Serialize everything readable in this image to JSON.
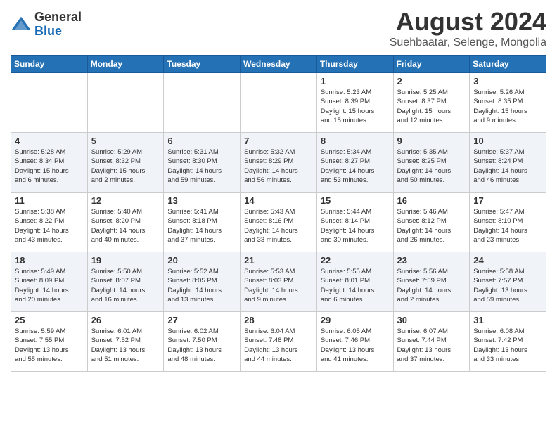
{
  "logo": {
    "general": "General",
    "blue": "Blue"
  },
  "title": "August 2024",
  "subtitle": "Suehbaatar, Selenge, Mongolia",
  "days_of_week": [
    "Sunday",
    "Monday",
    "Tuesday",
    "Wednesday",
    "Thursday",
    "Friday",
    "Saturday"
  ],
  "weeks": [
    [
      {
        "day": "",
        "info": ""
      },
      {
        "day": "",
        "info": ""
      },
      {
        "day": "",
        "info": ""
      },
      {
        "day": "",
        "info": ""
      },
      {
        "day": "1",
        "info": "Sunrise: 5:23 AM\nSunset: 8:39 PM\nDaylight: 15 hours\nand 15 minutes."
      },
      {
        "day": "2",
        "info": "Sunrise: 5:25 AM\nSunset: 8:37 PM\nDaylight: 15 hours\nand 12 minutes."
      },
      {
        "day": "3",
        "info": "Sunrise: 5:26 AM\nSunset: 8:35 PM\nDaylight: 15 hours\nand 9 minutes."
      }
    ],
    [
      {
        "day": "4",
        "info": "Sunrise: 5:28 AM\nSunset: 8:34 PM\nDaylight: 15 hours\nand 6 minutes."
      },
      {
        "day": "5",
        "info": "Sunrise: 5:29 AM\nSunset: 8:32 PM\nDaylight: 15 hours\nand 2 minutes."
      },
      {
        "day": "6",
        "info": "Sunrise: 5:31 AM\nSunset: 8:30 PM\nDaylight: 14 hours\nand 59 minutes."
      },
      {
        "day": "7",
        "info": "Sunrise: 5:32 AM\nSunset: 8:29 PM\nDaylight: 14 hours\nand 56 minutes."
      },
      {
        "day": "8",
        "info": "Sunrise: 5:34 AM\nSunset: 8:27 PM\nDaylight: 14 hours\nand 53 minutes."
      },
      {
        "day": "9",
        "info": "Sunrise: 5:35 AM\nSunset: 8:25 PM\nDaylight: 14 hours\nand 50 minutes."
      },
      {
        "day": "10",
        "info": "Sunrise: 5:37 AM\nSunset: 8:24 PM\nDaylight: 14 hours\nand 46 minutes."
      }
    ],
    [
      {
        "day": "11",
        "info": "Sunrise: 5:38 AM\nSunset: 8:22 PM\nDaylight: 14 hours\nand 43 minutes."
      },
      {
        "day": "12",
        "info": "Sunrise: 5:40 AM\nSunset: 8:20 PM\nDaylight: 14 hours\nand 40 minutes."
      },
      {
        "day": "13",
        "info": "Sunrise: 5:41 AM\nSunset: 8:18 PM\nDaylight: 14 hours\nand 37 minutes."
      },
      {
        "day": "14",
        "info": "Sunrise: 5:43 AM\nSunset: 8:16 PM\nDaylight: 14 hours\nand 33 minutes."
      },
      {
        "day": "15",
        "info": "Sunrise: 5:44 AM\nSunset: 8:14 PM\nDaylight: 14 hours\nand 30 minutes."
      },
      {
        "day": "16",
        "info": "Sunrise: 5:46 AM\nSunset: 8:12 PM\nDaylight: 14 hours\nand 26 minutes."
      },
      {
        "day": "17",
        "info": "Sunrise: 5:47 AM\nSunset: 8:10 PM\nDaylight: 14 hours\nand 23 minutes."
      }
    ],
    [
      {
        "day": "18",
        "info": "Sunrise: 5:49 AM\nSunset: 8:09 PM\nDaylight: 14 hours\nand 20 minutes."
      },
      {
        "day": "19",
        "info": "Sunrise: 5:50 AM\nSunset: 8:07 PM\nDaylight: 14 hours\nand 16 minutes."
      },
      {
        "day": "20",
        "info": "Sunrise: 5:52 AM\nSunset: 8:05 PM\nDaylight: 14 hours\nand 13 minutes."
      },
      {
        "day": "21",
        "info": "Sunrise: 5:53 AM\nSunset: 8:03 PM\nDaylight: 14 hours\nand 9 minutes."
      },
      {
        "day": "22",
        "info": "Sunrise: 5:55 AM\nSunset: 8:01 PM\nDaylight: 14 hours\nand 6 minutes."
      },
      {
        "day": "23",
        "info": "Sunrise: 5:56 AM\nSunset: 7:59 PM\nDaylight: 14 hours\nand 2 minutes."
      },
      {
        "day": "24",
        "info": "Sunrise: 5:58 AM\nSunset: 7:57 PM\nDaylight: 13 hours\nand 59 minutes."
      }
    ],
    [
      {
        "day": "25",
        "info": "Sunrise: 5:59 AM\nSunset: 7:55 PM\nDaylight: 13 hours\nand 55 minutes."
      },
      {
        "day": "26",
        "info": "Sunrise: 6:01 AM\nSunset: 7:52 PM\nDaylight: 13 hours\nand 51 minutes."
      },
      {
        "day": "27",
        "info": "Sunrise: 6:02 AM\nSunset: 7:50 PM\nDaylight: 13 hours\nand 48 minutes."
      },
      {
        "day": "28",
        "info": "Sunrise: 6:04 AM\nSunset: 7:48 PM\nDaylight: 13 hours\nand 44 minutes."
      },
      {
        "day": "29",
        "info": "Sunrise: 6:05 AM\nSunset: 7:46 PM\nDaylight: 13 hours\nand 41 minutes."
      },
      {
        "day": "30",
        "info": "Sunrise: 6:07 AM\nSunset: 7:44 PM\nDaylight: 13 hours\nand 37 minutes."
      },
      {
        "day": "31",
        "info": "Sunrise: 6:08 AM\nSunset: 7:42 PM\nDaylight: 13 hours\nand 33 minutes."
      }
    ]
  ]
}
